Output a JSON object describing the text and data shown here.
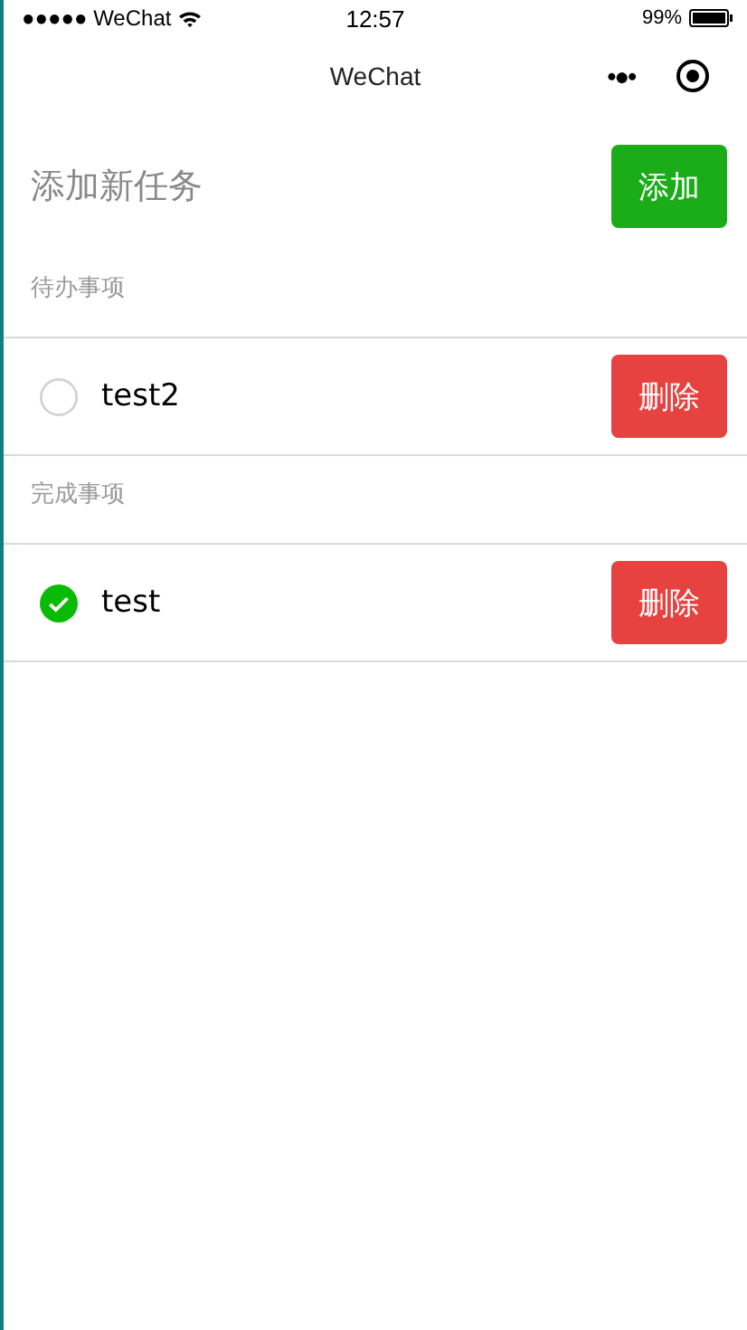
{
  "status_bar": {
    "carrier": "●●●●● WeChat",
    "time": "12:57",
    "battery": "99%"
  },
  "nav_bar": {
    "title": "WeChat",
    "more": "•●•"
  },
  "new_task": {
    "placeholder": "添加新任务",
    "button": "添加"
  },
  "sections": [
    {
      "title": "待办事项",
      "items": [
        {
          "text": "test2",
          "checked": false,
          "button": "删除"
        }
      ]
    },
    {
      "title": "完成事项",
      "items": [
        {
          "text": "test",
          "checked": true,
          "button": "删除"
        }
      ]
    }
  ]
}
